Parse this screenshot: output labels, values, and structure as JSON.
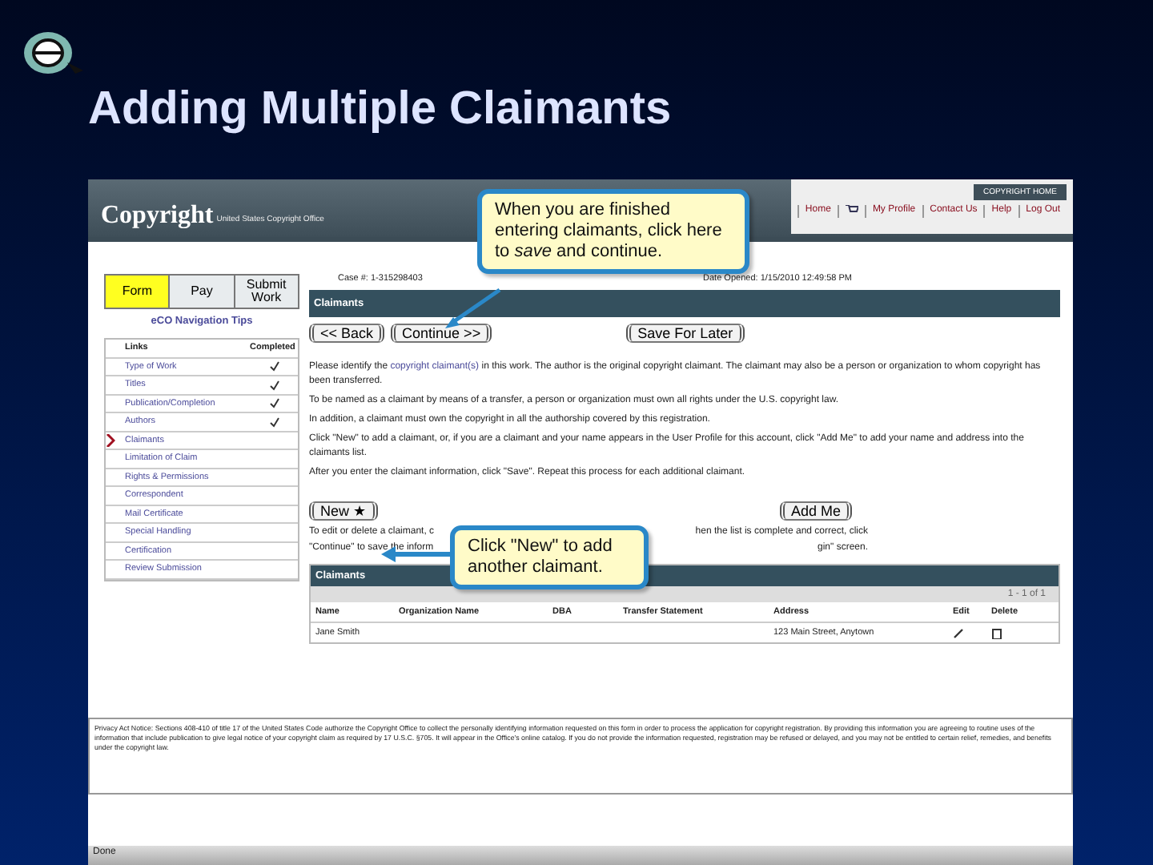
{
  "slide": {
    "title": "Adding Multiple Claimants"
  },
  "header": {
    "logo": "Copyright",
    "subtitle": "United States Copyright Office",
    "home_link": "COPYRIGHT HOME",
    "links": [
      {
        "label": "Home",
        "kind": "text"
      },
      {
        "kind": "cart"
      },
      {
        "label": "My Profile",
        "kind": "text"
      },
      {
        "label": "Contact Us",
        "kind": "text"
      },
      {
        "label": "Help",
        "kind": "text"
      },
      {
        "label": "Log Out",
        "kind": "text"
      }
    ]
  },
  "tabs": [
    {
      "label": "Form",
      "selected": true
    },
    {
      "label": "Pay",
      "selected": false
    },
    {
      "label": "Submit Work",
      "selected": false
    }
  ],
  "nav_tips": "eCO Navigation Tips",
  "nav_table": {
    "columns": [
      "Links",
      "Completed"
    ],
    "rows": [
      {
        "label": "Type of Work",
        "completed": true,
        "selected": false
      },
      {
        "label": "Titles",
        "completed": true,
        "selected": false
      },
      {
        "label": "Publication/Completion",
        "completed": true,
        "selected": false
      },
      {
        "label": "Authors",
        "completed": true,
        "selected": false
      },
      {
        "label": "Claimants",
        "completed": false,
        "selected": true
      },
      {
        "label": "Limitation of Claim",
        "completed": false,
        "selected": false
      },
      {
        "label": "Rights & Permissions",
        "completed": false,
        "selected": false
      },
      {
        "label": "Correspondent",
        "completed": false,
        "selected": false
      },
      {
        "label": "Mail Certificate",
        "completed": false,
        "selected": false
      },
      {
        "label": "Special Handling",
        "completed": false,
        "selected": false
      },
      {
        "label": "Certification",
        "completed": false,
        "selected": false
      },
      {
        "label": "Review Submission",
        "completed": false,
        "selected": false
      }
    ]
  },
  "case": {
    "case_label": "Case #:",
    "case_value": "1-315298403",
    "date_label": "Date Opened:",
    "date_value": "1/15/2010 12:49:58 PM"
  },
  "section_title": "Claimants",
  "buttons": [
    "<< Back",
    "Continue >>",
    "Save For Later"
  ],
  "paragraphs": [
    "Please identify the **copyright claimant(s)** in this work. The author is the original copyright claimant. The claimant may also be a person or organization to whom copyright has been transferred.",
    "To be named as a claimant by means of a transfer, a person or organization must own all rights under the U.S. copyright law.",
    "In addition, a claimant must own the copyright in all the authorship covered by this registration.",
    "Click \"New\" to add a claimant, or, if you are a claimant and your name appears in the User Profile for this account, click \"Add Me\" to add your name and address into the claimants list.",
    "After you enter the claimant information, click \"Save\". Repeat this process for each additional claimant."
  ],
  "new_button": "New ★",
  "add_me_button": "Add Me",
  "edit_note": [
    [
      "To edit or delete a claimant, c",
      "hen the list is complete and correct, click"
    ],
    [
      "\"Continue\" to save the inform",
      "gin\" screen."
    ]
  ],
  "claimants_table": {
    "title": "Claimants",
    "pager": "1 - 1 of 1",
    "columns": [
      "Name",
      "Organization Name",
      "DBA",
      "Transfer Statement",
      "Address",
      "Edit",
      "Delete"
    ],
    "rows": [
      [
        "Jane Smith",
        "",
        "",
        "",
        "123 Main Street, Anytown"
      ]
    ]
  },
  "privacy": "Privacy Act Notice: Sections 408-410 of title 17 of the United States Code authorize the Copyright Office to collect the personally identifying information requested on this form in order to process the application for copyright registration. By providing this information you are agreeing to routine uses of the information that include publication to give legal notice of your copyright claim as required by 17 U.S.C. §705. It will appear in the Office's online catalog. If you do not provide the information requested, registration may be refused or delayed, and you may not be entitled to certain relief, remedies, and benefits under the copyright law.",
  "status_bar": "Done",
  "callouts": [
    {
      "text": "When you are finished entering claimants, click here to *save* and continue.",
      "kind": "top"
    },
    {
      "text": "Click \"New\" to add another claimant.",
      "kind": "new"
    }
  ]
}
